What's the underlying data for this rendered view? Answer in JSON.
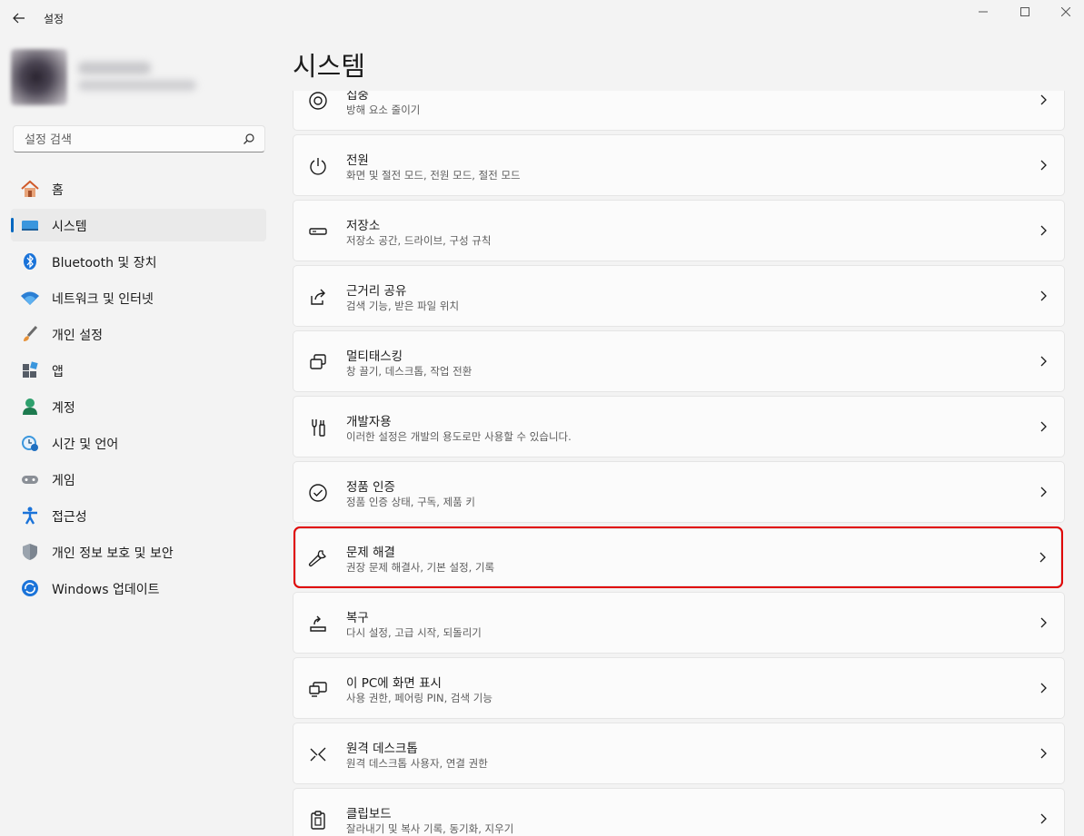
{
  "window": {
    "title": "설정",
    "minimize_glyph": "—",
    "maximize_glyph": "☐",
    "close_glyph": "✕"
  },
  "search": {
    "placeholder": "설정 검색"
  },
  "sidebar": {
    "items": [
      {
        "label": "홈",
        "icon": "home-icon"
      },
      {
        "label": "시스템",
        "icon": "system-icon",
        "selected": true
      },
      {
        "label": "Bluetooth 및 장치",
        "icon": "bluetooth-icon"
      },
      {
        "label": "네트워크 및 인터넷",
        "icon": "wifi-icon"
      },
      {
        "label": "개인 설정",
        "icon": "brush-icon"
      },
      {
        "label": "앱",
        "icon": "apps-icon"
      },
      {
        "label": "계정",
        "icon": "account-icon"
      },
      {
        "label": "시간 및 언어",
        "icon": "time-language-icon"
      },
      {
        "label": "게임",
        "icon": "gamepad-icon"
      },
      {
        "label": "접근성",
        "icon": "accessibility-icon"
      },
      {
        "label": "개인 정보 보호 및 보안",
        "icon": "shield-icon"
      },
      {
        "label": "Windows 업데이트",
        "icon": "update-icon"
      }
    ]
  },
  "main": {
    "title": "시스템",
    "cards": [
      {
        "title": "집중",
        "desc": "방해 요소 줄이기",
        "icon": "focus-icon"
      },
      {
        "title": "전원",
        "desc": "화면 및 절전 모드, 전원 모드, 절전 모드",
        "icon": "power-icon"
      },
      {
        "title": "저장소",
        "desc": "저장소 공간, 드라이브, 구성 규칙",
        "icon": "storage-icon"
      },
      {
        "title": "근거리 공유",
        "desc": "검색 기능, 받은 파일 위치",
        "icon": "share-icon"
      },
      {
        "title": "멀티태스킹",
        "desc": "창 끌기, 데스크톱, 작업 전환",
        "icon": "multitasking-icon"
      },
      {
        "title": "개발자용",
        "desc": "이러한 설정은 개발의 용도로만 사용할 수 있습니다.",
        "icon": "developer-icon"
      },
      {
        "title": "정품 인증",
        "desc": "정품 인증 상태, 구독, 제품 키",
        "icon": "activation-icon"
      },
      {
        "title": "문제 해결",
        "desc": "권장 문제 해결사, 기본 설정, 기록",
        "icon": "wrench-icon",
        "highlighted": true
      },
      {
        "title": "복구",
        "desc": "다시 설정, 고급 시작, 되돌리기",
        "icon": "recovery-icon"
      },
      {
        "title": "이 PC에 화면 표시",
        "desc": "사용 권한, 페어링 PIN, 검색 기능",
        "icon": "project-icon"
      },
      {
        "title": "원격 데스크톱",
        "desc": "원격 데스크톱 사용자, 연결 권한",
        "icon": "remote-desktop-icon"
      },
      {
        "title": "클립보드",
        "desc": "잘라내기 및 복사 기록, 동기화, 지우기",
        "icon": "clipboard-icon"
      }
    ]
  },
  "colors": {
    "accent": "#0067c0",
    "highlight_border": "#e00000",
    "background": "#f3f3f3",
    "card": "#fbfbfb"
  }
}
